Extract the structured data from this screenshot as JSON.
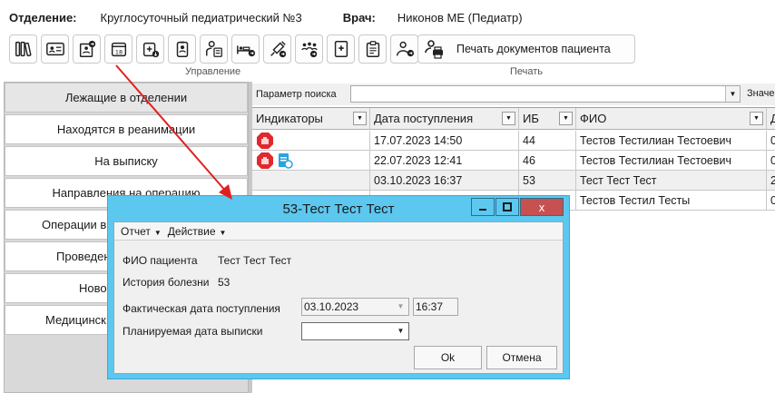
{
  "header": {
    "department_label": "Отделение:",
    "department_value": "Круглосуточный педиатрический №3",
    "doctor_label": "Врач:",
    "doctor_value": "Никонов МЕ (Педиатр)"
  },
  "toolbar": {
    "icons": [
      "books-icon",
      "id-card-icon",
      "patient-card-icon",
      "calendar-icon",
      "medical-bag-icon",
      "badge-icon",
      "patient-chart-icon",
      "bed-transfer-icon",
      "syringe-icon",
      "group-icon",
      "medical-book-icon",
      "clipboard-icon",
      "user-transfer-icon",
      "printer-user-icon"
    ],
    "print_label": "Печать документов пациента",
    "group_manage": "Управление",
    "group_print": "Печать"
  },
  "left_panel": {
    "items": [
      "Лежащие в отделении",
      "Находятся в реанимации",
      "На выписку",
      "Направления на операцию",
      "Операции в",
      "Проведен",
      "Ново",
      "Медицинск"
    ]
  },
  "search": {
    "label": "Параметр поиска",
    "right_label": "Значе"
  },
  "grid": {
    "columns": [
      "Индикаторы",
      "Дата поступления",
      "ИБ",
      "ФИО",
      "Д"
    ],
    "rows": [
      {
        "date": "17.07.2023 14:50",
        "ib": "44",
        "fio": "Тестов Тестилиан Тестоевич",
        "d": "0"
      },
      {
        "date": "22.07.2023 12:41",
        "ib": "46",
        "fio": "Тестов Тестилиан Тестоевич",
        "d": "0"
      },
      {
        "date": "03.10.2023 16:37",
        "ib": "53",
        "fio": "Тест Тест Тест",
        "d": "2"
      },
      {
        "date": "",
        "ib": "",
        "fio": "Тестов Тестил Тесты",
        "d": "0"
      }
    ]
  },
  "dialog": {
    "title": "53-Тест Тест Тест",
    "close_glyph": "x",
    "menu": [
      "Отчет",
      "Действие"
    ],
    "fio_label": "ФИО пациента",
    "fio_value": "Тест Тест Тест",
    "history_label": "История болезни",
    "history_value": "53",
    "actual_date_label": "Фактическая дата поступления",
    "actual_date": "03.10.2023",
    "actual_time": "16:37",
    "planned_date_label": "Планируемая дата выписки",
    "planned_date": "",
    "ok_label": "Ok",
    "cancel_label": "Отмена"
  },
  "colors": {
    "dialog_frame": "#5cc8f0",
    "close_button": "#c75050",
    "arrow": "#e02020",
    "indicator_red": "#e0282d",
    "indicator_blue": "#29a3e0"
  }
}
